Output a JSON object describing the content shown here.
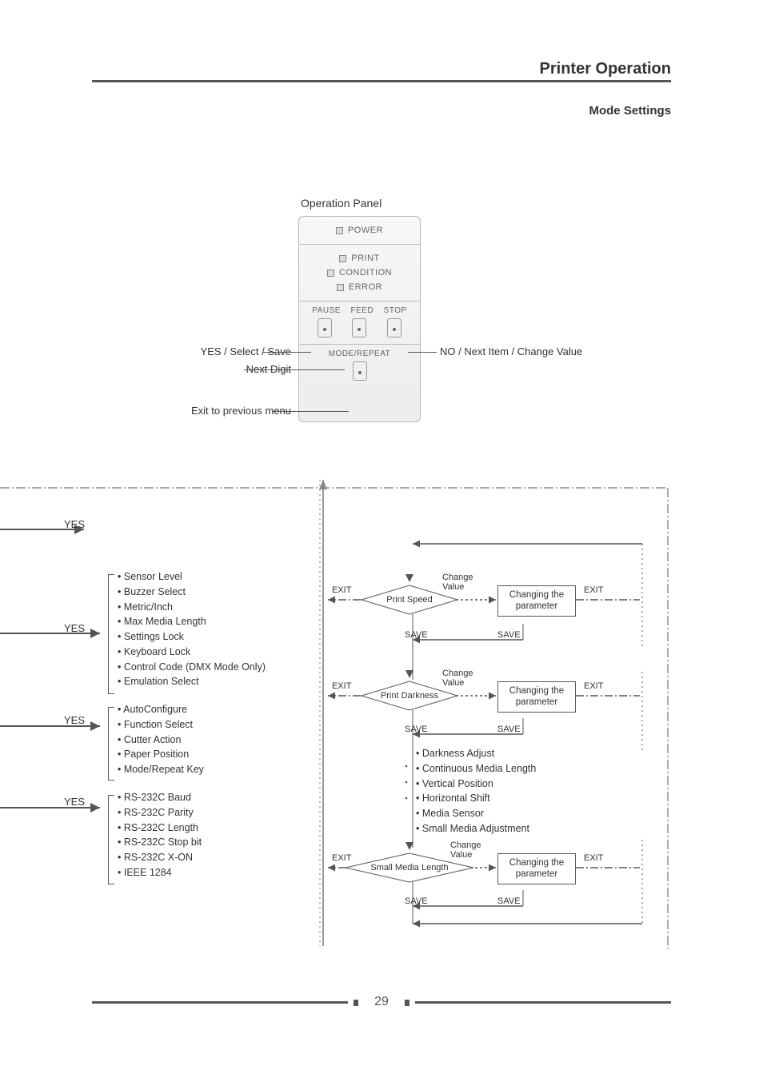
{
  "header": {
    "title": "Printer Operation",
    "sub": "Mode Settings"
  },
  "panel_title": "Operation Panel",
  "leds": {
    "power": "POWER",
    "print": "PRINT",
    "condition": "CONDITION",
    "error": "ERROR"
  },
  "row_labels": {
    "pause": "PAUSE",
    "feed": "FEED",
    "stop": "STOP",
    "mode": "MODE/REPEAT"
  },
  "callouts": {
    "yes": "YES / Select / Save",
    "next_digit": "Next Digit",
    "exit_prev": "Exit to previous menu",
    "no": "NO / Next Item / Change Value"
  },
  "yes": "YES",
  "lists": {
    "a": [
      "Sensor Level",
      "Buzzer Select",
      "Metric/Inch",
      "Max Media Length",
      "Settings Lock",
      "Keyboard Lock",
      "Control Code (DMX Mode Only)",
      "Emulation Select"
    ],
    "b": [
      "AutoConfigure",
      "Function Select",
      "Cutter Action",
      "Paper Position",
      "Mode/Repeat Key"
    ],
    "c": [
      "RS-232C Baud",
      "RS-232C Parity",
      "RS-232C Length",
      "RS-232C Stop bit",
      "RS-232C X-ON",
      "IEEE 1284"
    ],
    "d": [
      "Darkness Adjust",
      "Continuous Media Length",
      "Vertical Position",
      "Horizontal Shift",
      "Media Sensor",
      "Small Media Adjustment"
    ]
  },
  "flow": {
    "d1": "Print Speed",
    "d2": "Print Darkness",
    "d3": "Small Media Length",
    "box": "Changing the parameter",
    "exit": "EXIT",
    "save": "SAVE",
    "change": "Change Value"
  },
  "page_number": "29"
}
